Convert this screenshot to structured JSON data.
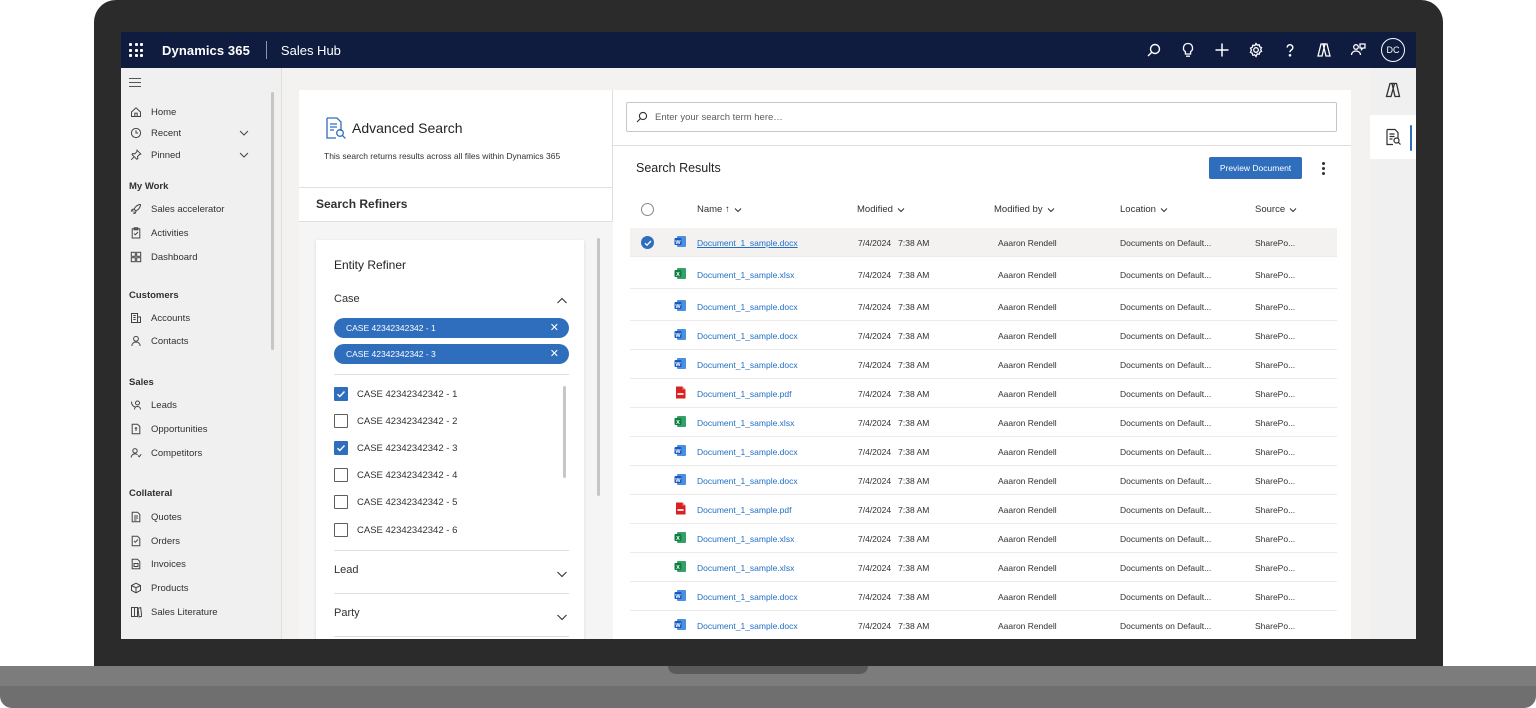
{
  "app": {
    "name": "Dynamics 365",
    "hub": "Sales Hub",
    "avatar_initials": "DC"
  },
  "nav": {
    "top_items": [
      {
        "label": "Home",
        "icon": "home-icon"
      },
      {
        "label": "Recent",
        "icon": "clock-icon"
      },
      {
        "label": "Pinned",
        "icon": "pin-icon"
      }
    ],
    "sections": [
      {
        "title": "My Work",
        "items": [
          {
            "label": "Sales accelerator",
            "icon": "rocket-icon"
          },
          {
            "label": "Activities",
            "icon": "clipboard-icon"
          },
          {
            "label": "Dashboard",
            "icon": "dashboard-icon"
          }
        ]
      },
      {
        "title": "Customers",
        "items": [
          {
            "label": "Accounts",
            "icon": "building-icon"
          },
          {
            "label": "Contacts",
            "icon": "person-icon"
          }
        ]
      },
      {
        "title": "Sales",
        "items": [
          {
            "label": "Leads",
            "icon": "phone-person-icon"
          },
          {
            "label": "Opportunities",
            "icon": "document-icon"
          },
          {
            "label": "Competitors",
            "icon": "person-icon"
          }
        ]
      },
      {
        "title": "Collateral",
        "items": [
          {
            "label": "Quotes",
            "icon": "quote-doc-icon"
          },
          {
            "label": "Orders",
            "icon": "order-doc-icon"
          },
          {
            "label": "Invoices",
            "icon": "invoice-icon"
          },
          {
            "label": "Products",
            "icon": "box-icon"
          },
          {
            "label": "Sales Literature",
            "icon": "books-icon"
          }
        ]
      }
    ]
  },
  "advanced_search": {
    "title": "Advanced Search",
    "description": "This search returns results across all files within Dynamics 365",
    "refiners_title": "Search Refiners",
    "entity_refiner_title": "Entity Refiner",
    "case_label": "Case",
    "selected_pills": [
      "CASE 42342342342 - 1",
      "CASE 42342342342 - 3"
    ],
    "case_options": [
      {
        "label": "CASE 42342342342 - 1",
        "checked": true
      },
      {
        "label": "CASE 42342342342 - 2",
        "checked": false
      },
      {
        "label": "CASE 42342342342 - 3",
        "checked": true
      },
      {
        "label": "CASE 42342342342 - 4",
        "checked": false
      },
      {
        "label": "CASE 42342342342 - 5",
        "checked": false
      },
      {
        "label": "CASE 42342342342 - 6",
        "checked": false
      }
    ],
    "other_refiners": [
      "Lead",
      "Party"
    ]
  },
  "results": {
    "search_placeholder": "Enter your search term here…",
    "title": "Search Results",
    "preview_button": "Preview Document",
    "columns": {
      "name": "Name ↑",
      "modified": "Modified",
      "modified_by": "Modified by",
      "location": "Location",
      "source": "Source"
    },
    "rows": [
      {
        "type": "docx",
        "name": "Document_1_sample.docx",
        "modified": "7/4/2024   7:38 AM",
        "modified_by": "Aaaron Rendell",
        "location": "Documents on Default...",
        "source": "SharePo...",
        "selected": true
      },
      {
        "type": "xlsx",
        "name": "Document_1_sample.xlsx",
        "modified": "7/4/2024   7:38 AM",
        "modified_by": "Aaaron Rendell",
        "location": "Documents on Default...",
        "source": "SharePo...",
        "selected": false
      },
      {
        "type": "docx",
        "name": "Document_1_sample.docx",
        "modified": "7/4/2024   7:38 AM",
        "modified_by": "Aaaron Rendell",
        "location": "Documents on Default...",
        "source": "SharePo...",
        "selected": false
      },
      {
        "type": "docx",
        "name": "Document_1_sample.docx",
        "modified": "7/4/2024   7:38 AM",
        "modified_by": "Aaaron Rendell",
        "location": "Documents on Default...",
        "source": "SharePo...",
        "selected": false
      },
      {
        "type": "docx",
        "name": "Document_1_sample.docx",
        "modified": "7/4/2024   7:38 AM",
        "modified_by": "Aaaron Rendell",
        "location": "Documents on Default...",
        "source": "SharePo...",
        "selected": false
      },
      {
        "type": "pdf",
        "name": "Document_1_sample.pdf",
        "modified": "7/4/2024   7:38 AM",
        "modified_by": "Aaaron Rendell",
        "location": "Documents on Default...",
        "source": "SharePo...",
        "selected": false
      },
      {
        "type": "xlsx",
        "name": "Document_1_sample.xlsx",
        "modified": "7/4/2024   7:38 AM",
        "modified_by": "Aaaron Rendell",
        "location": "Documents on Default...",
        "source": "SharePo...",
        "selected": false
      },
      {
        "type": "docx",
        "name": "Document_1_sample.docx",
        "modified": "7/4/2024   7:38 AM",
        "modified_by": "Aaaron Rendell",
        "location": "Documents on Default...",
        "source": "SharePo...",
        "selected": false
      },
      {
        "type": "docx",
        "name": "Document_1_sample.docx",
        "modified": "7/4/2024   7:38 AM",
        "modified_by": "Aaaron Rendell",
        "location": "Documents on Default...",
        "source": "SharePo...",
        "selected": false
      },
      {
        "type": "pdf",
        "name": "Document_1_sample.pdf",
        "modified": "7/4/2024   7:38 AM",
        "modified_by": "Aaaron Rendell",
        "location": "Documents on Default...",
        "source": "SharePo...",
        "selected": false
      },
      {
        "type": "xlsx",
        "name": "Document_1_sample.xlsx",
        "modified": "7/4/2024   7:38 AM",
        "modified_by": "Aaaron Rendell",
        "location": "Documents on Default...",
        "source": "SharePo...",
        "selected": false
      },
      {
        "type": "xlsx",
        "name": "Document_1_sample.xlsx",
        "modified": "7/4/2024   7:38 AM",
        "modified_by": "Aaaron Rendell",
        "location": "Documents on Default...",
        "source": "SharePo...",
        "selected": false
      },
      {
        "type": "docx",
        "name": "Document_1_sample.docx",
        "modified": "7/4/2024   7:38 AM",
        "modified_by": "Aaaron Rendell",
        "location": "Documents on Default...",
        "source": "SharePo...",
        "selected": false
      },
      {
        "type": "docx",
        "name": "Document_1_sample.docx",
        "modified": "7/4/2024   7:38 AM",
        "modified_by": "Aaaron Rendell",
        "location": "Documents on Default...",
        "source": "SharePo...",
        "selected": false
      }
    ]
  },
  "colors": {
    "topbar": "#0f1c3f",
    "accent": "#2f6dbd",
    "word": "#185abd",
    "excel": "#107c41",
    "pdf": "#d92121"
  }
}
